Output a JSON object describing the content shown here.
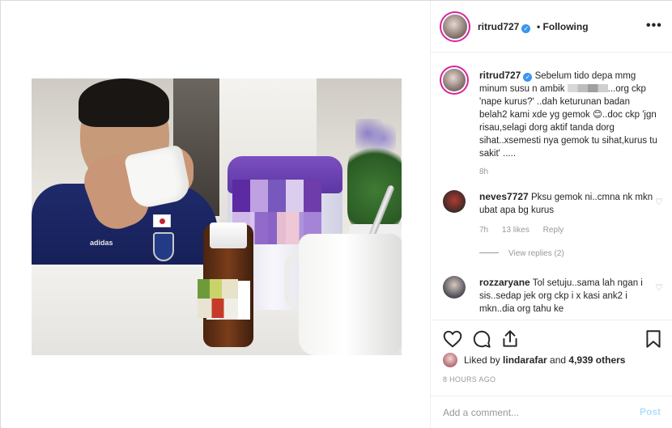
{
  "header": {
    "username": "ritrud727",
    "follow_status": "• Following",
    "more_label": "•••"
  },
  "caption": {
    "username": "ritrud727",
    "text": "Sebelum tido depa mmg minum susu n ambik ",
    "text_after": "...org ckp 'nape kurus?' ..dah keturunan badan belah2 kami xde yg gemok 😊..doc ckp 'jgn risau,selagi dorg aktif tanda dorg sihat..xsemesti nya gemok tu sihat,kurus tu sakit' .....",
    "time": "8h"
  },
  "comments": [
    {
      "username": "neves7727",
      "text": "Pksu gemok ni..cmna nk mkn ubat apa bg kurus",
      "time": "7h",
      "likes": "13 likes",
      "reply_label": "Reply",
      "view_replies": "View replies (2)"
    },
    {
      "username": "rozzaryane",
      "text": "Tol setuju..sama lah ngan i sis..sedap jek org ckp i x kasi ank2 i mkn..dia org tahu ke"
    }
  ],
  "likes": {
    "prefix": "Liked by ",
    "user": "lindarafar",
    "middle": " and ",
    "count": "4,939 others"
  },
  "posted_ago": "8 HOURS AGO",
  "add_comment": {
    "placeholder": "Add a comment...",
    "post_label": "Post"
  },
  "photo_text": {
    "shirt_brand": "adidas"
  },
  "colors": {
    "verified_blue": "#3897f0",
    "post_button_disabled": "#b2dffc",
    "story_ring": "#d6249f"
  },
  "icons": [
    "heart-icon",
    "comment-icon",
    "share-icon",
    "bookmark-icon",
    "verified-icon",
    "more-icon"
  ]
}
